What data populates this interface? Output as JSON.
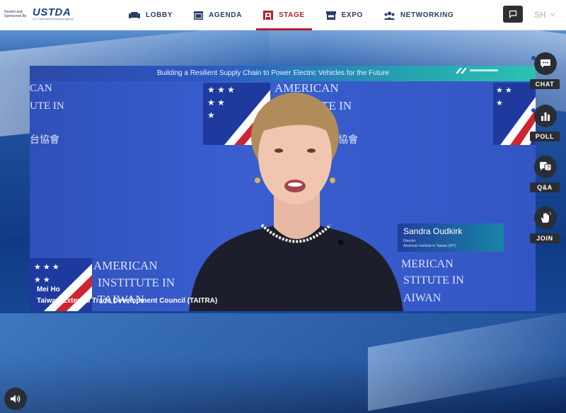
{
  "sponsor": {
    "label": "Hosted and Sponsored By",
    "logo_text": "USTDA",
    "tagline": "U.S. Trade and Development Agency"
  },
  "nav": {
    "items": [
      {
        "label": "LOBBY",
        "icon": "sofa-icon"
      },
      {
        "label": "AGENDA",
        "icon": "calendar-icon"
      },
      {
        "label": "STAGE",
        "icon": "stage-icon",
        "active": true
      },
      {
        "label": "EXPO",
        "icon": "booth-icon"
      },
      {
        "label": "NETWORKING",
        "icon": "people-icon"
      }
    ],
    "active_color": "#b3202f"
  },
  "user": {
    "initials": "SH"
  },
  "video": {
    "banner_title": "Building a Resilient Supply Chain to Power Electric Vehicles for the Future",
    "wall_text_1": "AMERICAN",
    "wall_text_2": "INSTITUTE IN",
    "wall_text_3": "TAIWAN",
    "wall_text_cn": "台協會",
    "wall_left_a": "CAN",
    "wall_left_b": "UTE IN",
    "wall_left_c": "台協會",
    "wall_right_a": "MERICAN",
    "wall_right_b": "STITUTE IN",
    "wall_right_c": "AIWAN",
    "wall_mid_cn": "協會",
    "nameplate_name": "Sandra Oudkirk",
    "nameplate_title": "Director",
    "nameplate_org": "American Institute in Taiwan (AIT)",
    "caption_name": "Mei Ho",
    "caption_org": "Taiwan External Trade Development Council (TAITRA)"
  },
  "tools": [
    {
      "label": "CHAT",
      "icon": "chat-icon"
    },
    {
      "label": "POLL",
      "icon": "poll-icon"
    },
    {
      "label": "Q&A",
      "icon": "qa-icon"
    },
    {
      "label": "JOIN",
      "icon": "hand-icon"
    }
  ]
}
